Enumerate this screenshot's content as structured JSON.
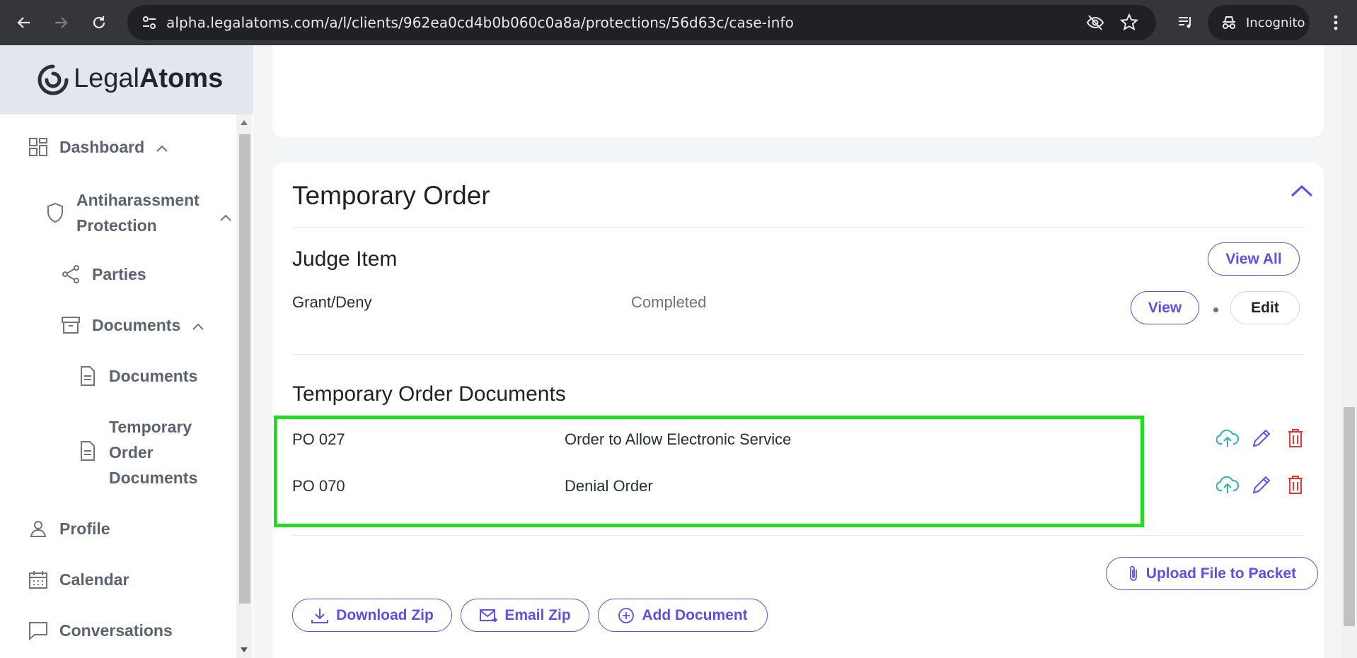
{
  "browser": {
    "url": "alpha.legalatoms.com/a/l/clients/962ea0cd4b0b060c0a8a/protections/56d63c/case-info",
    "incognito_label": "Incognito"
  },
  "sidebar": {
    "logo_light": "Legal",
    "logo_bold": "Atoms",
    "items": {
      "dashboard": "Dashboard",
      "protection_line1": "Antiharassment",
      "protection_line2": "Protection",
      "parties": "Parties",
      "documents_group": "Documents",
      "documents": "Documents",
      "tod_line1": "Temporary",
      "tod_line2": "Order",
      "tod_line3": "Documents",
      "profile": "Profile",
      "calendar": "Calendar",
      "conversations": "Conversations"
    }
  },
  "main": {
    "section_title": "Temporary Order",
    "judge_item": {
      "title": "Judge Item",
      "view_all": "View All",
      "row_name": "Grant/Deny",
      "row_status": "Completed",
      "view": "View",
      "edit": "Edit"
    },
    "documents": {
      "title": "Temporary Order Documents",
      "rows": [
        {
          "code": "PO 027",
          "name": "Order to Allow Electronic Service"
        },
        {
          "code": "PO 070",
          "name": "Denial Order"
        }
      ]
    },
    "buttons": {
      "upload": "Upload File to Packet",
      "download_zip": "Download Zip",
      "email_zip": "Email Zip",
      "add_document": "Add Document"
    }
  },
  "colors": {
    "accent": "#5a50ee",
    "highlight": "#22dd22",
    "upload_icon": "#2bb5a8",
    "delete_icon": "#e53935"
  }
}
